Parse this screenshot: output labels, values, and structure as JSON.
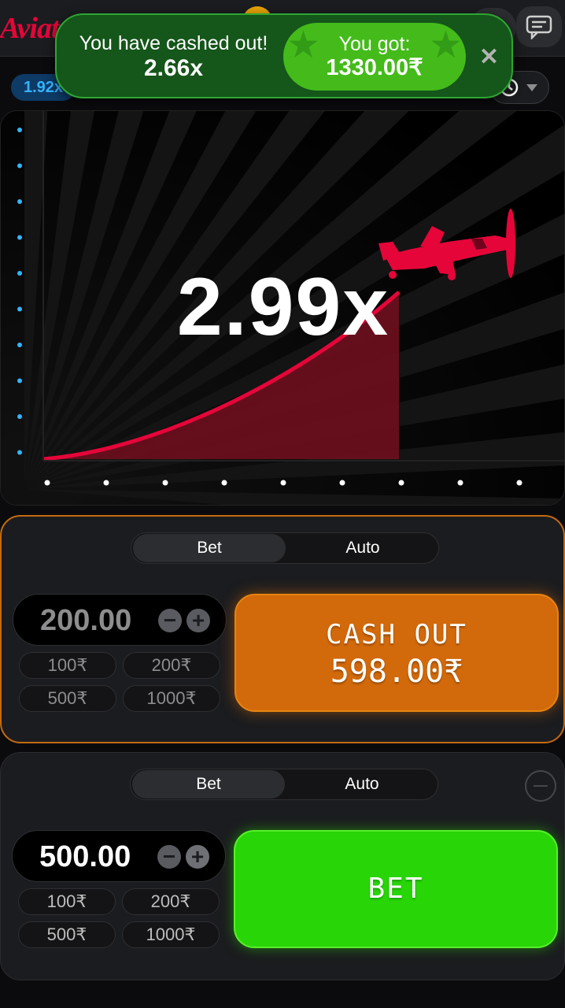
{
  "header": {
    "logo_text": "Aviat",
    "chat_icon": "chat-bubble-icon"
  },
  "toast": {
    "message": "You have cashed out!",
    "multiplier": "2.66x",
    "win_label": "You got:",
    "win_amount": "1330.00₹",
    "close_icon": "close-icon"
  },
  "history": {
    "first_multiplier": "1.92x",
    "history_icon": "history-clock-icon",
    "dropdown_icon": "chevron-down-icon"
  },
  "game": {
    "multiplier": "2.99x",
    "curve_color": "#e50539",
    "plane_color": "#e50539",
    "axis_dot_color_y": "#34b4ff",
    "axis_dot_color_x": "#ffffff"
  },
  "panel1": {
    "tab_bet": "Bet",
    "tab_auto": "Auto",
    "amount": "200.00",
    "minus": "−",
    "plus": "+",
    "quick": [
      "100₹",
      "200₹",
      "500₹",
      "1000₹"
    ],
    "cashout_label": "CASH OUT",
    "cashout_amount": "598.00₹",
    "accent": "#d2690a"
  },
  "panel2": {
    "tab_bet": "Bet",
    "tab_auto": "Auto",
    "amount": "500.00",
    "minus": "−",
    "plus": "+",
    "quick": [
      "100₹",
      "200₹",
      "500₹",
      "1000₹"
    ],
    "bet_label": "BET",
    "accent": "#28d507"
  }
}
